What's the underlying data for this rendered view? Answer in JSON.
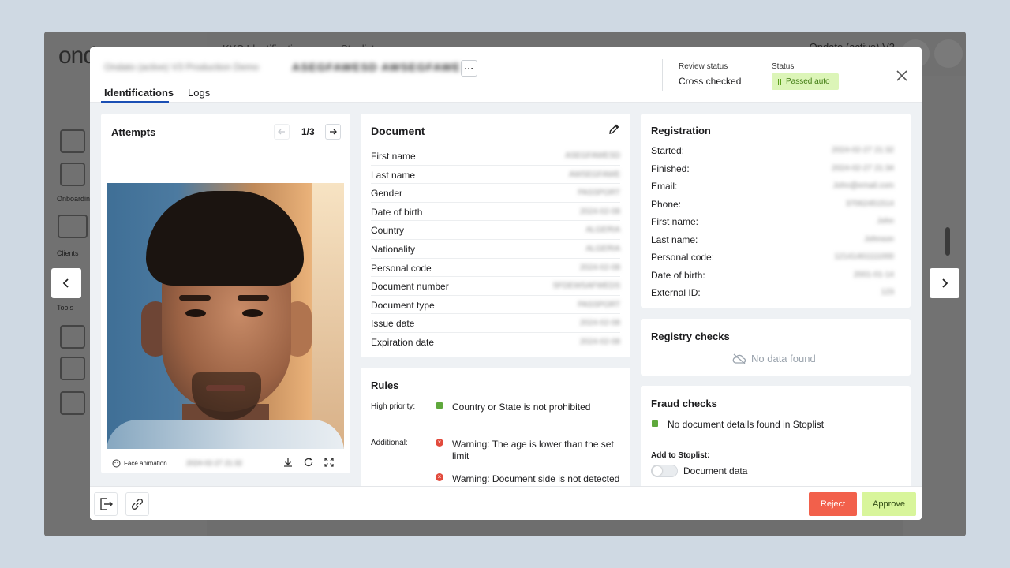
{
  "background_app": {
    "logo": "ond",
    "tabs": [
      "KYC Identification",
      "Stoplist"
    ],
    "brand": "Ondato (active) V3",
    "sidebar_labels": [
      "Onboarding",
      "Clients",
      "Tools"
    ]
  },
  "header": {
    "org_blurred": "Ondato (active) V3 Production Demo",
    "id_blurred": "ASEGFAWESD AWSEGFAWE",
    "more_label": "···",
    "tabs": [
      {
        "label": "Identifications",
        "active": true
      },
      {
        "label": "Logs",
        "active": false
      }
    ],
    "review_status_label": "Review status",
    "review_status_value": "Cross checked",
    "status_label": "Status",
    "status_value": "Passed auto"
  },
  "attempts": {
    "title": "Attempts",
    "pager": "1/3",
    "footer_label": "Face animation",
    "footer_date_blurred": "2024-02-27 21:32"
  },
  "document": {
    "title": "Document",
    "rows": [
      {
        "label": "First name",
        "value": "ASEGFAWESD"
      },
      {
        "label": "Last name",
        "value": "AWSEGFAWE"
      },
      {
        "label": "Gender",
        "value": "PASSPORT"
      },
      {
        "label": "Date of birth",
        "value": "2024-02-08"
      },
      {
        "label": "Country",
        "value": "ALGERIA"
      },
      {
        "label": "Nationality",
        "value": "ALGERIA"
      },
      {
        "label": "Personal code",
        "value": "2024-02-08"
      },
      {
        "label": "Document number",
        "value": "SFDEWSAFWEDS"
      },
      {
        "label": "Document type",
        "value": "PASSPORT"
      },
      {
        "label": "Issue date",
        "value": "2024-02-08"
      },
      {
        "label": "Expiration date",
        "value": "2024-02-08"
      }
    ]
  },
  "rules": {
    "title": "Rules",
    "high_priority_label": "High priority:",
    "high_priority_items": [
      "Country or State is not prohibited"
    ],
    "additional_label": "Additional:",
    "additional_items": [
      "Warning: The age is lower than the set limit",
      "Warning: Document side is not detected"
    ]
  },
  "registration": {
    "title": "Registration",
    "rows": [
      {
        "label": "Started:",
        "value": "2024-02-27 21:32"
      },
      {
        "label": "Finished:",
        "value": "2024-02-27 21:34"
      },
      {
        "label": "Email:",
        "value": "John@email.com"
      },
      {
        "label": "Phone:",
        "value": "37062451514"
      },
      {
        "label": "First name:",
        "value": "John"
      },
      {
        "label": "Last name:",
        "value": "Johnson"
      },
      {
        "label": "Personal code:",
        "value": "12141461111000"
      },
      {
        "label": "Date of birth:",
        "value": "2001-01-14"
      },
      {
        "label": "External ID:",
        "value": "123"
      }
    ]
  },
  "registry_checks": {
    "title": "Registry checks",
    "empty_text": "No data found"
  },
  "fraud_checks": {
    "title": "Fraud checks",
    "item": "No document details found in Stoplist",
    "add_label": "Add to Stoplist:",
    "toggle_label": "Document data",
    "toggle_on": false
  },
  "footer": {
    "reject_label": "Reject",
    "approve_label": "Approve"
  },
  "colors": {
    "accent": "#1b4fb4",
    "reject": "#f2604b",
    "approve": "#d8f59b",
    "passed_badge": "#dcf5b8",
    "check_green": "#5fa83c",
    "warning_red": "#e24a3c"
  }
}
